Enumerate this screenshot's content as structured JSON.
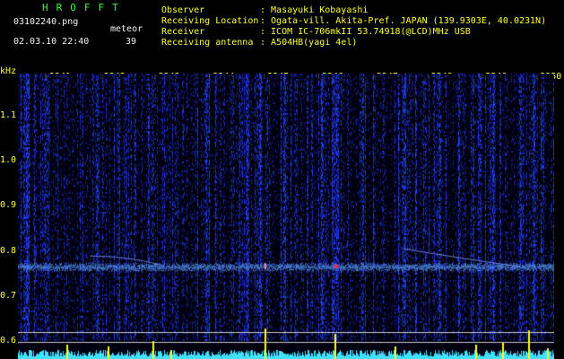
{
  "header": {
    "program": "HROFFT",
    "filename": "03102240.png",
    "detector_label": "meteor",
    "datetime": "02.03.10 22:40",
    "count": "39",
    "info": [
      {
        "label": "Observer",
        "value": ": Masayuki Kobayashi"
      },
      {
        "label": "Receiving Location",
        "value": ": Ogata-vill. Akita-Pref. JAPAN (139.9303E, 40.0231N)"
      },
      {
        "label": "Receiver",
        "value": ": ICOM IC-706mkII 53.74918(@LCD)MHz USB"
      },
      {
        "label": "Receiving antenna",
        "value": ": A504HB(yagi 4el)"
      }
    ]
  },
  "chart_data": {
    "type": "heatmap",
    "ylabel": "kHz",
    "yticks": [
      "1.1",
      "1.0",
      "0.9",
      "0.8",
      "0.7",
      "0.6"
    ],
    "ytick_values": [
      1.1,
      1.0,
      0.9,
      0.8,
      0.7,
      0.6
    ],
    "xticks": [
      "2241",
      "2242",
      "2243",
      "2244",
      "2245",
      "2246",
      "2247",
      "2248",
      "2249",
      "2250"
    ],
    "carrier_khz": 0.765,
    "colors": {
      "background": "#000010",
      "noise": "#1e28c8",
      "carrier": "#6aa8ff",
      "signal": "#ff3030",
      "baseline": "#40e0ff",
      "spike": "#ffff00"
    }
  }
}
